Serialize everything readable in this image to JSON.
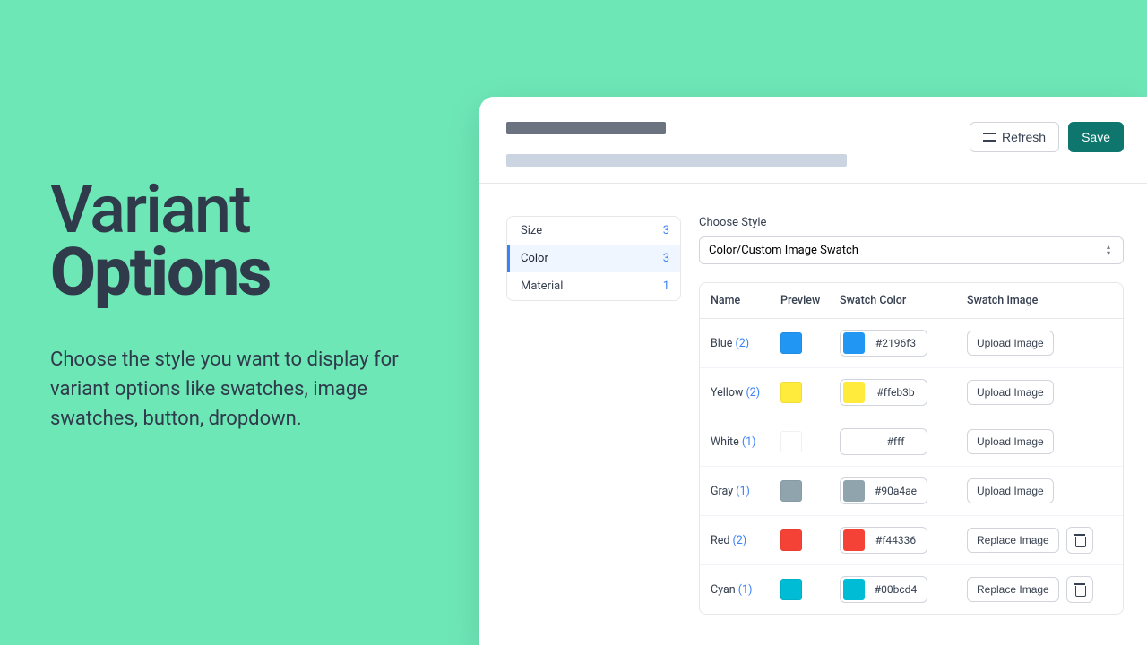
{
  "hero": {
    "title_line1": "Variant",
    "title_line2": "Options",
    "subtitle": "Choose the style you want to display for variant options like swatches, image swatches, button, dropdown."
  },
  "toolbar": {
    "refresh_label": "Refresh",
    "save_label": "Save"
  },
  "sidebar": {
    "items": [
      {
        "label": "Size",
        "count": "3",
        "active": false
      },
      {
        "label": "Color",
        "count": "3",
        "active": true
      },
      {
        "label": "Material",
        "count": "1",
        "active": false
      }
    ]
  },
  "style_picker": {
    "label": "Choose Style",
    "selected": "Color/Custom Image Swatch"
  },
  "table": {
    "headers": {
      "name": "Name",
      "preview": "Preview",
      "swatch_color": "Swatch Color",
      "swatch_image": "Swatch Image"
    },
    "rows": [
      {
        "name": "Blue",
        "count": "(2)",
        "color": "#2196f3",
        "hex": "#2196f3",
        "action": "Upload Image",
        "deletable": false
      },
      {
        "name": "Yellow",
        "count": "(2)",
        "color": "#ffeb3b",
        "hex": "#ffeb3b",
        "action": "Upload Image",
        "deletable": false
      },
      {
        "name": "White",
        "count": "(1)",
        "color": "#ffffff",
        "hex": "#fff",
        "action": "Upload Image",
        "deletable": false
      },
      {
        "name": "Gray",
        "count": "(1)",
        "color": "#90a4ae",
        "hex": "#90a4ae",
        "action": "Upload Image",
        "deletable": false
      },
      {
        "name": "Red",
        "count": "(2)",
        "color": "#f44336",
        "hex": "#f44336",
        "action": "Replace Image",
        "deletable": true
      },
      {
        "name": "Cyan",
        "count": "(1)",
        "color": "#00bcd4",
        "hex": "#00bcd4",
        "action": "Replace Image",
        "deletable": true
      }
    ]
  }
}
